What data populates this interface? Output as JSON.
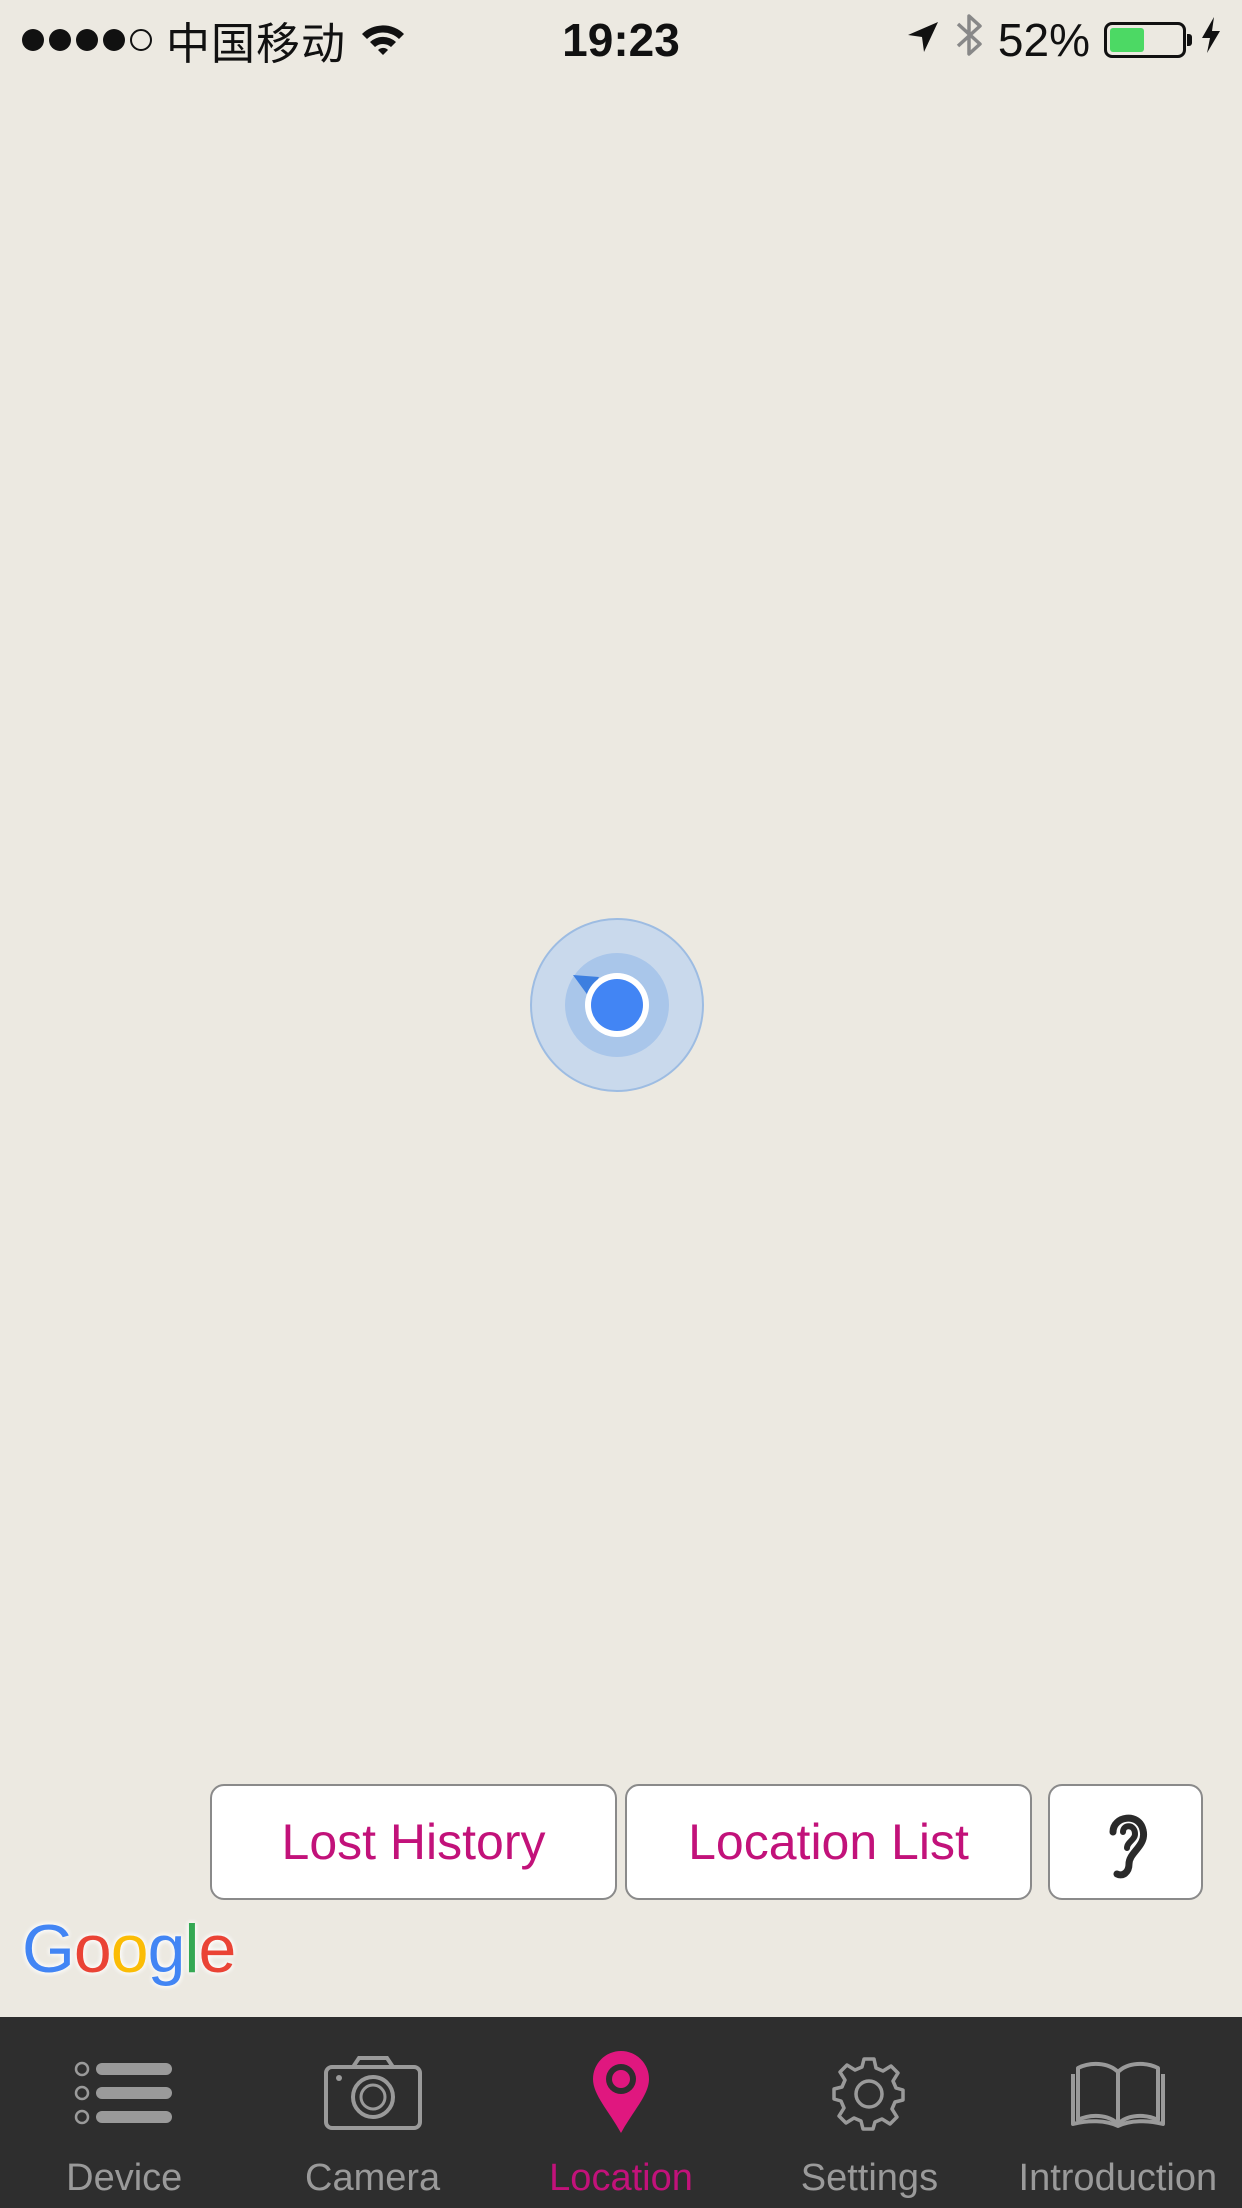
{
  "status_bar": {
    "carrier": "中国移动",
    "time": "19:23",
    "battery_percent": "52%",
    "battery_level": 0.52,
    "icons": [
      "signal-dots",
      "wifi-icon",
      "location-arrow-icon",
      "bluetooth-icon",
      "battery-icon",
      "charging-bolt-icon"
    ]
  },
  "map": {
    "marker_icon": "current-location-icon",
    "buttons": {
      "lost_history": "Lost History",
      "location_list": "Location List",
      "sound_icon": "ear-icon"
    },
    "attribution": [
      "G",
      "o",
      "o",
      "g",
      "l",
      "e"
    ],
    "attribution_colors": [
      "#4285F4",
      "#EA4335",
      "#FBBC05",
      "#4285F4",
      "#34A853",
      "#EA4335"
    ]
  },
  "tab_bar": {
    "tabs": [
      {
        "label": "Device",
        "icon": "list-icon",
        "active": false
      },
      {
        "label": "Camera",
        "icon": "camera-icon",
        "active": false
      },
      {
        "label": "Location",
        "icon": "location-pin-icon",
        "active": true
      },
      {
        "label": "Settings",
        "icon": "gear-icon",
        "active": false
      },
      {
        "label": "Introduction",
        "icon": "book-icon",
        "active": false
      }
    ]
  },
  "colors": {
    "accent": "#C2127A",
    "map_background": "#ECE9E1",
    "tab_bar_background": "#2E2E2E",
    "tab_inactive": "#9A9A9A",
    "location_blue": "#4285F4"
  }
}
